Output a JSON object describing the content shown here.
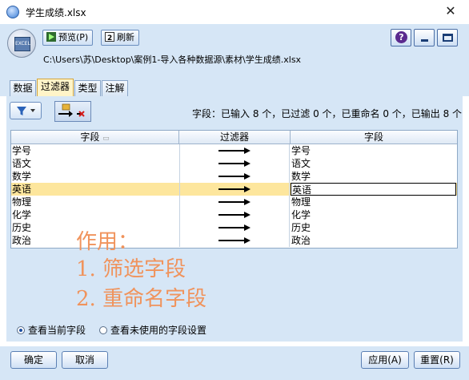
{
  "window": {
    "title": "学生成绩.xlsx",
    "close_glyph": "✕"
  },
  "toolbar": {
    "preview_label": "预览(P)",
    "refresh_label": "刷新",
    "file_path": "C:\\Users\\苏\\Desktop\\案例1-导入各种数据源\\素材\\学生成绩.xlsx",
    "icon_label": "EXCEL",
    "help_glyph": "?"
  },
  "tabs": [
    {
      "label": "数据",
      "active": false
    },
    {
      "label": "过滤器",
      "active": true
    },
    {
      "label": "类型",
      "active": false
    },
    {
      "label": "注解",
      "active": false
    }
  ],
  "filter": {
    "summary": "字段：已输入 8 个，已过滤 0 个，已重命名 0 个，已输出 8 个"
  },
  "table": {
    "columns": [
      "字段",
      "过滤器",
      "字段"
    ],
    "sort_glyph": "▭",
    "rows": [
      {
        "field": "学号",
        "new_field": "学号"
      },
      {
        "field": "语文",
        "new_field": "语文"
      },
      {
        "field": "数学",
        "new_field": "数学"
      },
      {
        "field": "英语",
        "new_field": "英语",
        "selected": true
      },
      {
        "field": "物理",
        "new_field": "物理"
      },
      {
        "field": "化学",
        "new_field": "化学"
      },
      {
        "field": "历史",
        "new_field": "历史"
      },
      {
        "field": "政治",
        "new_field": "政治"
      }
    ]
  },
  "annotation": {
    "line1": "作用：",
    "line2": "1. 筛选字段",
    "line3": "2. 重命名字段"
  },
  "view_options": {
    "current_label": "查看当前字段",
    "unused_label": "查看未使用的字段设置",
    "selected": "current"
  },
  "buttons": {
    "ok": "确定",
    "cancel": "取消",
    "apply": "应用(A)",
    "reset": "重置(R)"
  },
  "colors": {
    "accent_orange": "#f0935c",
    "selected_row": "#fde69d",
    "panel_bg": "#d6e6f6"
  }
}
